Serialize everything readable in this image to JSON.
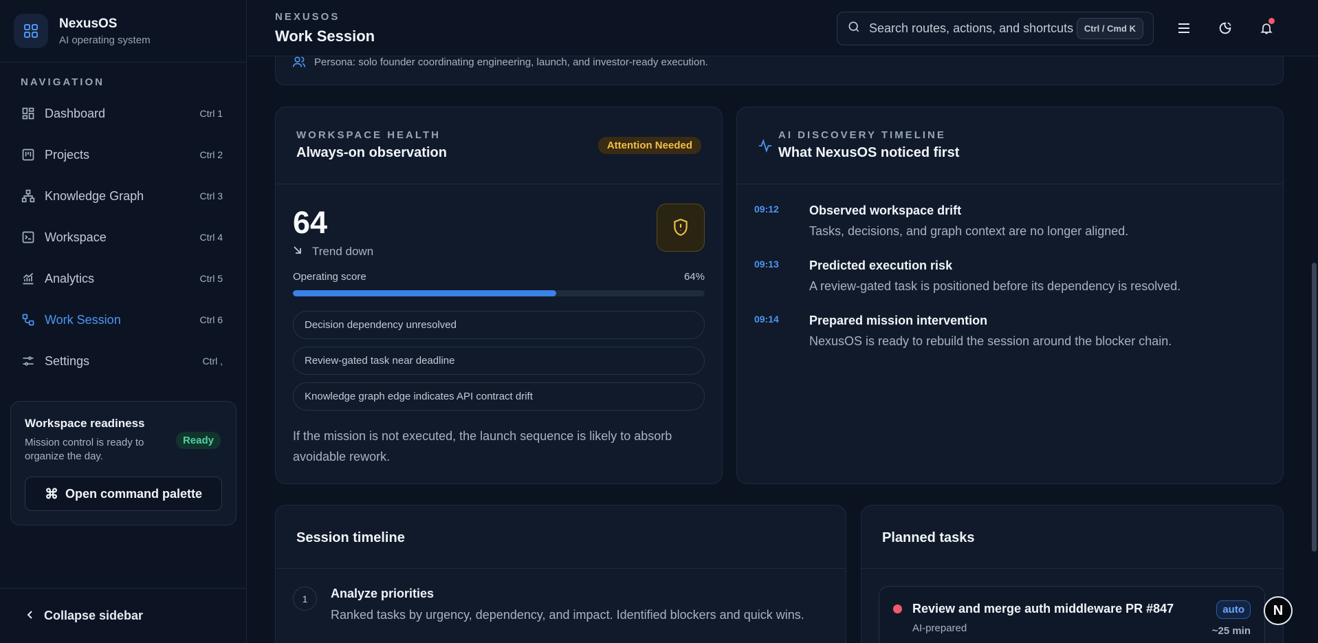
{
  "brand": {
    "name": "NexusOS",
    "subtitle": "AI operating system"
  },
  "nav": {
    "heading": "NAVIGATION",
    "items": [
      {
        "label": "Dashboard",
        "shortcut": "Ctrl 1",
        "icon": "dashboard-icon"
      },
      {
        "label": "Projects",
        "shortcut": "Ctrl 2",
        "icon": "projects-icon"
      },
      {
        "label": "Knowledge Graph",
        "shortcut": "Ctrl 3",
        "icon": "graph-icon"
      },
      {
        "label": "Workspace",
        "shortcut": "Ctrl 4",
        "icon": "workspace-icon"
      },
      {
        "label": "Analytics",
        "shortcut": "Ctrl 5",
        "icon": "analytics-icon"
      },
      {
        "label": "Work Session",
        "shortcut": "Ctrl 6",
        "icon": "work-session-icon",
        "active": true
      },
      {
        "label": "Settings",
        "shortcut": "Ctrl ,",
        "icon": "settings-icon"
      }
    ]
  },
  "readiness": {
    "title": "Workspace readiness",
    "description": "Mission control is ready to organize the day.",
    "badge": "Ready",
    "command_button": "Open command palette"
  },
  "collapse_label": "Collapse sidebar",
  "topbar": {
    "eyebrow": "NEXUSOS",
    "title": "Work Session",
    "search_placeholder": "Search routes, actions, and shortcuts",
    "search_shortcut": "Ctrl / Cmd K"
  },
  "persona": "Persona: solo founder coordinating engineering, launch, and investor-ready execution.",
  "health": {
    "eyebrow": "WORKSPACE HEALTH",
    "title": "Always-on observation",
    "badge": "Attention Needed",
    "score": "64",
    "trend": "Trend down",
    "operating_label": "Operating score",
    "operating_value": "64%",
    "operating_fraction": 0.64,
    "signals": [
      "Decision dependency unresolved",
      "Review-gated task near deadline",
      "Knowledge graph edge indicates API contract drift"
    ],
    "note": "If the mission is not executed, the launch sequence is likely to absorb avoidable rework."
  },
  "discovery": {
    "eyebrow": "AI DISCOVERY TIMELINE",
    "title": "What NexusOS noticed first",
    "items": [
      {
        "time": "09:12",
        "title": "Observed workspace drift",
        "desc": "Tasks, decisions, and graph context are no longer aligned."
      },
      {
        "time": "09:13",
        "title": "Predicted execution risk",
        "desc": "A review-gated task is positioned before its dependency is resolved."
      },
      {
        "time": "09:14",
        "title": "Prepared mission intervention",
        "desc": "NexusOS is ready to rebuild the session around the blocker chain."
      }
    ]
  },
  "session_timeline": {
    "title": "Session timeline",
    "steps": [
      {
        "num": "1",
        "title": "Analyze priorities",
        "desc": "Ranked tasks by urgency, dependency, and impact. Identified blockers and quick wins."
      }
    ]
  },
  "planned_tasks": {
    "title": "Planned tasks",
    "items": [
      {
        "title": "Review and merge auth middleware PR #847",
        "sub": "AI-prepared",
        "badge": "auto",
        "estimate": "~25 min"
      }
    ]
  },
  "avatar_initial": "N",
  "colors": {
    "accent": "#4e95f2",
    "warning": "#f2bf4a",
    "success": "#4fd1a5",
    "danger": "#f05a6e"
  }
}
